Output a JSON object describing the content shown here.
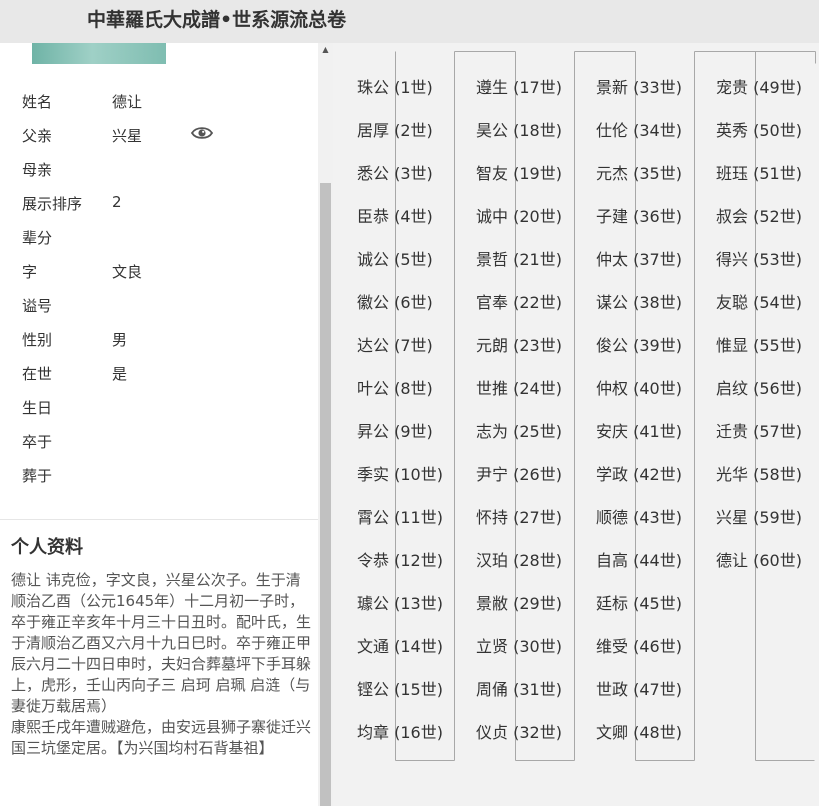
{
  "header": {
    "title": "中華羅氏大成譜•世系源流总卷"
  },
  "person": {
    "fields": [
      {
        "label": "姓名",
        "value": "德让"
      },
      {
        "label": "父亲",
        "value": "兴星"
      },
      {
        "label": "母亲",
        "value": ""
      },
      {
        "label": "展示排序",
        "value": "2"
      },
      {
        "label": "辈分",
        "value": ""
      },
      {
        "label": "字",
        "value": "文良"
      },
      {
        "label": "谥号",
        "value": ""
      },
      {
        "label": "性别",
        "value": "男"
      },
      {
        "label": "在世",
        "value": "是"
      },
      {
        "label": "生日",
        "value": ""
      },
      {
        "label": "卒于",
        "value": ""
      },
      {
        "label": "葬于",
        "value": ""
      }
    ]
  },
  "profile": {
    "title": "个人资料",
    "bio_1": "德让  讳克俭，字文良，兴星公次子。生于清顺治乙酉（公元1645年）十二月初一子时，卒于雍正辛亥年十月三十日丑时。配叶氏，生于清顺治乙酉又六月十九日巳时。卒于雍正甲辰六月二十四日申时，夫妇合葬墓坪下手耳躲上，虎形，壬山丙向子三  启珂  启珮  启涟（与妻徙万载居焉）",
    "bio_2": "康熙壬戌年遭贼避危，由安远县狮子寨徙迁兴国三坑堡定居。【为兴国均村石背基祖】"
  },
  "generations": [
    "珠公 (1世)",
    "居厚 (2世)",
    "悉公 (3世)",
    "臣恭 (4世)",
    "诚公 (5世)",
    "徽公 (6世)",
    "达公 (7世)",
    "叶公 (8世)",
    "昇公 (9世)",
    "季实 (10世)",
    "霄公 (11世)",
    "令恭 (12世)",
    "璩公 (13世)",
    "文通 (14世)",
    "铿公 (15世)",
    "均章 (16世)",
    "遵生 (17世)",
    "昊公 (18世)",
    "智友 (19世)",
    "诚中 (20世)",
    "景哲 (21世)",
    "官奉 (22世)",
    "元朗 (23世)",
    "世推 (24世)",
    "志为 (25世)",
    "尹宁 (26世)",
    "怀持 (27世)",
    "汉珀 (28世)",
    "景敝 (29世)",
    "立贤 (30世)",
    "周俑 (31世)",
    "仪贞 (32世)",
    "景新 (33世)",
    "仕伦 (34世)",
    "元杰 (35世)",
    "子建 (36世)",
    "仲太 (37世)",
    "谋公 (38世)",
    "俊公 (39世)",
    "仲权 (40世)",
    "安庆 (41世)",
    "学政 (42世)",
    "顺德 (43世)",
    "自高 (44世)",
    "廷标 (45世)",
    "维受 (46世)",
    "世政 (47世)",
    "文卿 (48世)",
    "宠贵 (49世)",
    "英秀 (50世)",
    "班珏 (51世)",
    "叔会 (52世)",
    "得兴 (53世)",
    "友聪 (54世)",
    "惟显 (55世)",
    "启纹 (56世)",
    "迁贵 (57世)",
    "光华 (58世)",
    "兴星 (59世)",
    "德让 (60世)"
  ]
}
